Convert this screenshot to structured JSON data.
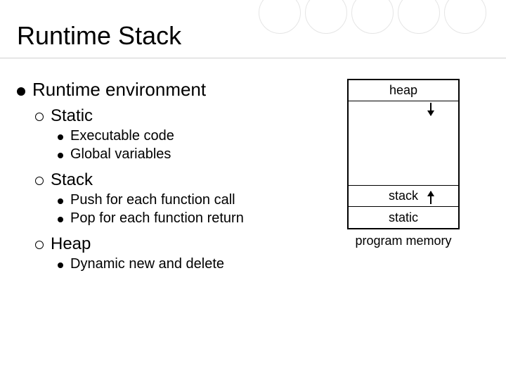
{
  "slide": {
    "title": "Runtime Stack",
    "heading": "Runtime environment",
    "sections": [
      {
        "label": "Static",
        "items": [
          "Executable code",
          "Global variables"
        ]
      },
      {
        "label": "Stack",
        "items": [
          "Push for each function call",
          "Pop for each function return"
        ]
      },
      {
        "label": "Heap",
        "items": [
          "Dynamic new and delete"
        ]
      }
    ]
  },
  "diagram": {
    "rows": [
      "heap",
      "",
      "",
      "stack",
      "static"
    ],
    "caption": "program memory"
  }
}
